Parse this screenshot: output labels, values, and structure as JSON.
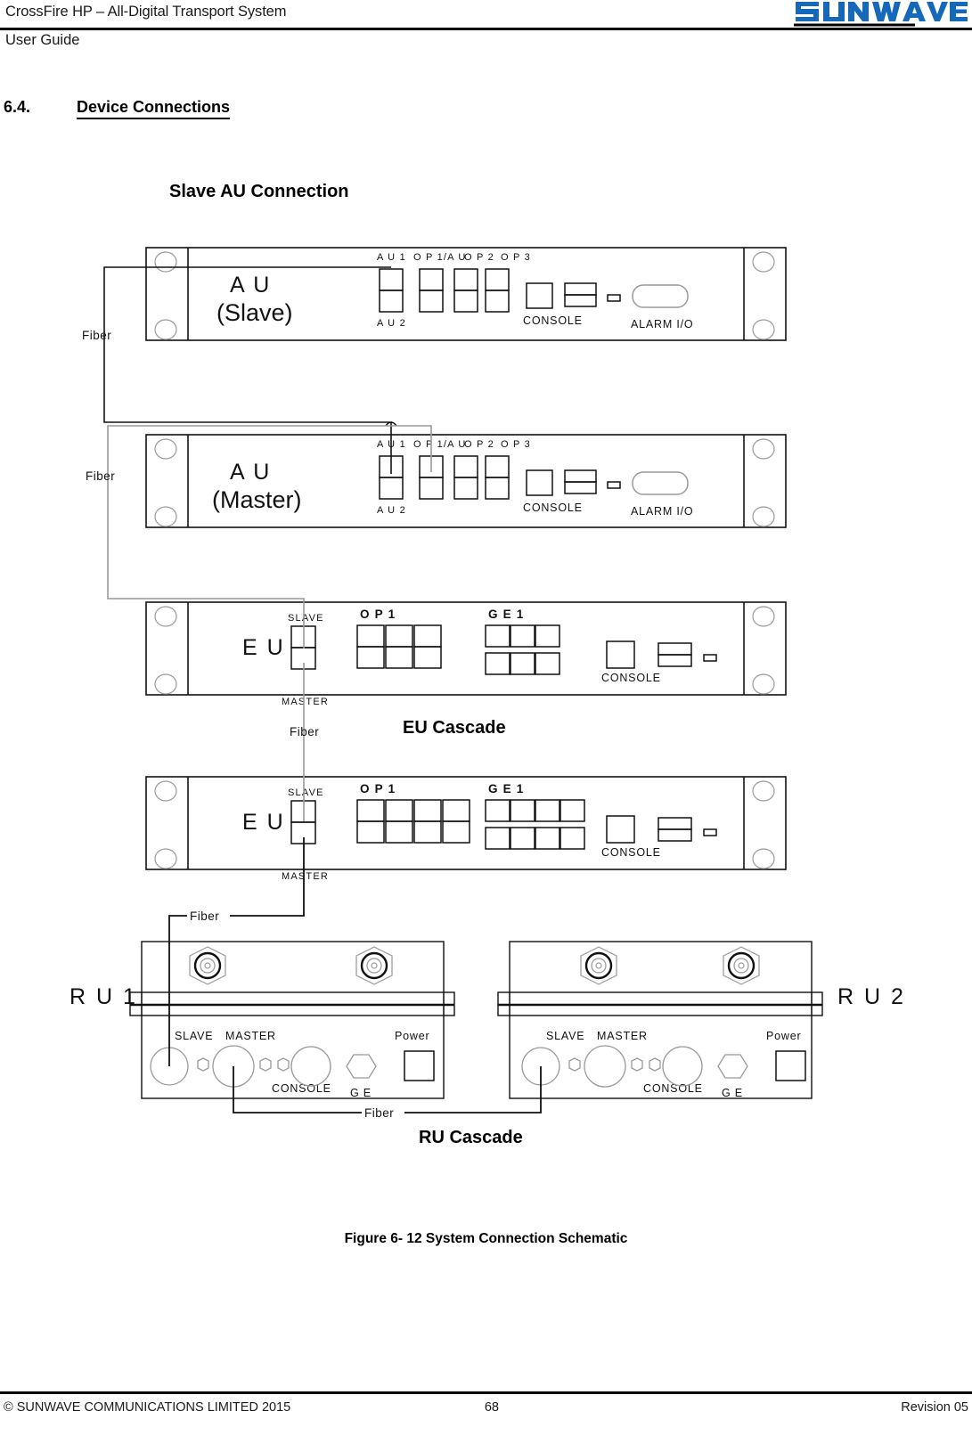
{
  "header": {
    "title": "CrossFire HP – All-Digital Transport System",
    "subtitle": "User Guide",
    "logo_text": "SUNWAVE",
    "logo_color": "#1668b8"
  },
  "section": {
    "number": "6.4.",
    "title": "Device Connections"
  },
  "figure": {
    "slave_au_title": "Slave AU Connection",
    "eu_cascade_title": "EU Cascade",
    "ru_cascade_title": "RU Cascade",
    "caption": "Figure 6- 12 System Connection Schematic"
  },
  "devices": {
    "au_slave": {
      "name": "A U",
      "variant": "(Slave)",
      "ports": [
        "A U 1",
        "O P 1/A U",
        "O P 2",
        "O P 3"
      ],
      "port_lower_label": "A U 2",
      "console_label": "CONSOLE",
      "alarm_label": "ALARM I/O"
    },
    "au_master": {
      "name": "A U",
      "variant": "(Master)",
      "ports": [
        "A U 1",
        "O P 1/A U",
        "O P 2",
        "O P 3"
      ],
      "port_lower_label": "A U 2",
      "console_label": "CONSOLE",
      "alarm_label": "ALARM I/O"
    },
    "eu_top": {
      "name": "E U",
      "slave_label": "SLAVE",
      "master_label": "MASTER",
      "op_label": "O P 1",
      "ge_label": "G E 1",
      "console_label": "CONSOLE",
      "op_columns": 3,
      "ge_columns": 3
    },
    "eu_bottom": {
      "name": "E U",
      "slave_label": "SLAVE",
      "master_label": "MASTER",
      "op_label": "O P 1",
      "ge_label": "G E 1",
      "console_label": "CONSOLE",
      "op_columns": 4,
      "ge_columns": 4
    },
    "ru1": {
      "name": "R U 1",
      "slave_label": "SLAVE",
      "master_label": "MASTER",
      "console_label": "CONSOLE",
      "ge_label": "G E",
      "power_label": "Power"
    },
    "ru2": {
      "name": "R U 2",
      "slave_label": "SLAVE",
      "master_label": "MASTER",
      "console_label": "CONSOLE",
      "ge_label": "G E",
      "power_label": "Power"
    }
  },
  "cables": {
    "fiber_au_slave": "Fiber",
    "fiber_au_master": "Fiber",
    "fiber_eu_cascade": "Fiber",
    "fiber_eu_to_ru": "Fiber",
    "fiber_ru_cascade": "Fiber"
  },
  "footer": {
    "copyright": "© SUNWAVE COMMUNICATIONS LIMITED 2015",
    "page": "68",
    "revision": "Revision 05"
  }
}
